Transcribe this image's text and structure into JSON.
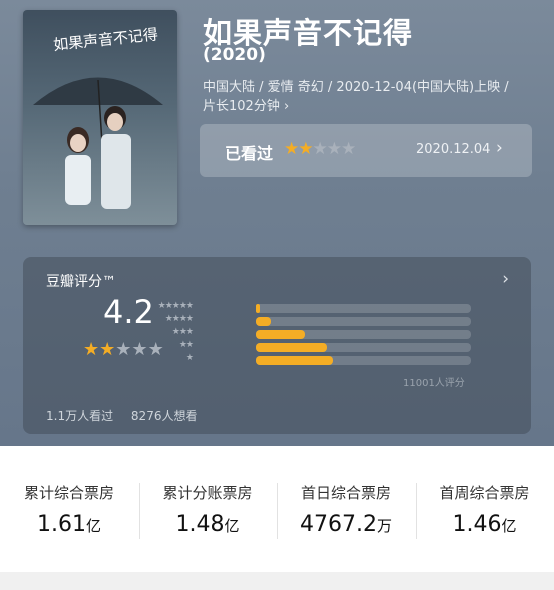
{
  "movie": {
    "title": "如果声音不记得",
    "year": "(2020)",
    "meta": "中国大陆 / 爱情 奇幻 / 2020-12-04(中国大陆)上映 / 片长102分钟 ›"
  },
  "watched": {
    "label": "已看过",
    "stars": "★★★★★",
    "user_rating": 2,
    "date": "2020.12.04",
    "chevron": "›"
  },
  "rating": {
    "title": "豆瓣评分™",
    "chevron": "›",
    "score": "4.2",
    "stars_filled": 2,
    "distribution": [
      {
        "stars": "★★★★★",
        "fraction": 0.02
      },
      {
        "stars": "★★★★",
        "fraction": 0.07
      },
      {
        "stars": "★★★",
        "fraction": 0.23
      },
      {
        "stars": "★★",
        "fraction": 0.33
      },
      {
        "stars": "★",
        "fraction": 0.36
      }
    ],
    "count": "11001人评分",
    "seen": "1.1万人看过",
    "want": "8276人想看"
  },
  "box_office": [
    {
      "label": "累计综合票房",
      "value": "1.61",
      "unit": "亿"
    },
    {
      "label": "累计分账票房",
      "value": "1.48",
      "unit": "亿"
    },
    {
      "label": "首日综合票房",
      "value": "4767.2",
      "unit": "万"
    },
    {
      "label": "首周综合票房",
      "value": "1.46",
      "unit": "亿"
    }
  ],
  "colors": {
    "star_filled": "#f4ad25",
    "star_empty": "#a9b1bb"
  }
}
